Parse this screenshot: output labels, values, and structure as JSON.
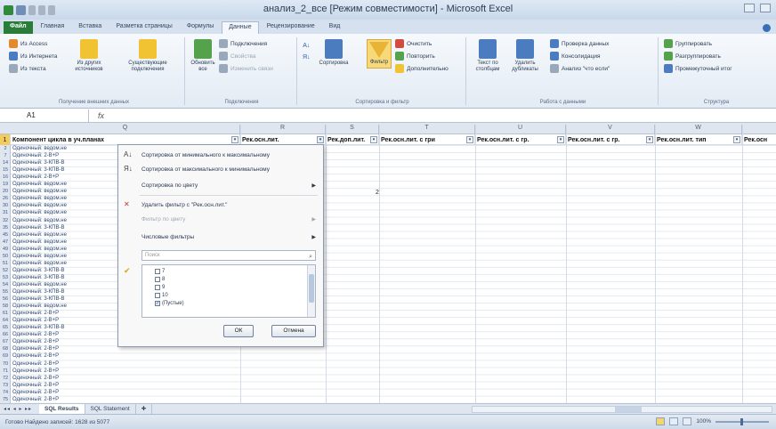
{
  "window": {
    "title": "анализ_2_все  [Режим совместимости]  -  Microsoft Excel"
  },
  "tabs": [
    {
      "label": "Файл"
    },
    {
      "label": "Главная"
    },
    {
      "label": "Вставка"
    },
    {
      "label": "Разметка страницы"
    },
    {
      "label": "Формулы"
    },
    {
      "label": "Данные"
    },
    {
      "label": "Рецензирование"
    },
    {
      "label": "Вид"
    }
  ],
  "ribbon": {
    "ext_data": {
      "from_access": "Из Access",
      "from_web": "Из Интернета",
      "from_text": "Из текста",
      "from_other": "Из других источников",
      "existing": "Существующие подключения",
      "label": "Получение внешних данных"
    },
    "connections": {
      "refresh_all": "Обновить все",
      "connections": "Подключения",
      "properties": "Свойства",
      "edit_links": "Изменить связи",
      "label": "Подключения"
    },
    "sort_filter": {
      "sort": "Сортировка",
      "filter": "Фильтр",
      "clear": "Очистить",
      "reapply": "Повторить",
      "advanced": "Дополнительно",
      "label": "Сортировка и фильтр"
    },
    "data_tools": {
      "text_to_columns": "Текст по столбцам",
      "remove_duplicates": "Удалить дубликаты",
      "validation": "Проверка данных",
      "consolidate": "Консолидация",
      "what_if": "Анализ \"что если\"",
      "label": "Работа с данными"
    },
    "outline": {
      "group": "Группировать",
      "ungroup": "Разгруппировать",
      "subtotal": "Промежуточный итог",
      "label": "Структура"
    }
  },
  "formula_bar": {
    "name_box": "A1",
    "fx": "fx",
    "value": ""
  },
  "columns": {
    "q": "Q",
    "r": "R",
    "s": "S",
    "t": "T",
    "u": "U",
    "v": "V",
    "w": "W"
  },
  "header_row": {
    "row_num": "1",
    "q": "Компонент цикла в уч.планах",
    "r": "Рек.осн.лит.",
    "s": "Рек.доп.лит.",
    "t": "Рек.осн.лит. с гри",
    "u": "Рек.осн.лит. с гр.",
    "v": "Рек.осн.лит. с гр.",
    "w": "Рек.осн.лит. тип",
    "x": "Рек.осн"
  },
  "rows": [
    {
      "num": "2",
      "q": "Одиночный: ведом.не"
    },
    {
      "num": "7",
      "q": "Одиночный: 2-В+Р"
    },
    {
      "num": "14",
      "q": "Одиночный: 3-КПВ-В"
    },
    {
      "num": "15",
      "q": "Одиночный: 3-КПВ-В"
    },
    {
      "num": "16",
      "q": "Одиночный: 2-В+Р"
    },
    {
      "num": "19",
      "q": "Одиночный: ведом.не"
    },
    {
      "num": "20",
      "q": "Одиночный: ведом.не"
    },
    {
      "num": "26",
      "q": "Одиночный: ведом.не"
    },
    {
      "num": "30",
      "q": "Одиночный: ведом.не"
    },
    {
      "num": "31",
      "q": "Одиночный: ведом.не"
    },
    {
      "num": "32",
      "q": "Одиночный: ведом.не"
    },
    {
      "num": "35",
      "q": "Одиночный: 3-КПВ-В"
    },
    {
      "num": "45",
      "q": "Одиночный: ведом.не"
    },
    {
      "num": "47",
      "q": "Одиночный: ведом.не"
    },
    {
      "num": "49",
      "q": "Одиночный: ведом.не"
    },
    {
      "num": "50",
      "q": "Одиночный: ведом.не"
    },
    {
      "num": "51",
      "q": "Одиночный: ведом.не"
    },
    {
      "num": "52",
      "q": "Одиночный: 3-КПВ-В"
    },
    {
      "num": "53",
      "q": "Одиночный: 3-КПВ-В"
    },
    {
      "num": "54",
      "q": "Одиночный: ведом.не"
    },
    {
      "num": "55",
      "q": "Одиночный: 3-КПВ-В"
    },
    {
      "num": "56",
      "q": "Одиночный: 3-КПВ-В"
    },
    {
      "num": "58",
      "q": "Одиночный: ведом.не"
    },
    {
      "num": "61",
      "q": "Одиночный: 2-В+Р"
    },
    {
      "num": "64",
      "q": "Одиночный: 2-В+Р"
    },
    {
      "num": "65",
      "q": "Одиночный: 3-КПВ-В"
    },
    {
      "num": "66",
      "q": "Одиночный: 2-В+Р"
    },
    {
      "num": "67",
      "q": "Одиночный: 2-В+Р"
    },
    {
      "num": "68",
      "q": "Одиночный: 2-В+Р"
    },
    {
      "num": "69",
      "q": "Одиночный: 2-В+Р"
    },
    {
      "num": "70",
      "q": "Одиночный: 2-В+Р"
    },
    {
      "num": "71",
      "q": "Одиночный: 2-В+Р"
    },
    {
      "num": "72",
      "q": "Одиночный: 2-В+Р"
    },
    {
      "num": "73",
      "q": "Одиночный: 2-В+Р"
    },
    {
      "num": "74",
      "q": "Одиночный: 2-В+Р"
    },
    {
      "num": "75",
      "q": "Одиночный: 2-В+Р"
    }
  ],
  "cell_value_s": "2",
  "filter_menu": {
    "sort_asc": "Сортировка от минимального к максимальному",
    "sort_desc": "Сортировка от максимального к минимальному",
    "sort_color": "Сортировка по цвету",
    "clear_filter": "Удалить фильтр с \"Рек.осн.лит.\"",
    "filter_color": "Фильтр по цвету",
    "number_filters": "Числовые фильтры",
    "search_placeholder": "Поиск",
    "items": [
      {
        "label": "7",
        "checked": false
      },
      {
        "label": "8",
        "checked": false
      },
      {
        "label": "9",
        "checked": false
      },
      {
        "label": "10",
        "checked": false
      },
      {
        "label": "(Пустые)",
        "checked": true
      }
    ],
    "ok": "ОК",
    "cancel": "Отмена"
  },
  "sheets": [
    {
      "label": "SQL Results",
      "active": true
    },
    {
      "label": "SQL Statement",
      "active": false
    }
  ],
  "status": {
    "text": "Готово   Найдено записей: 1628 из 5077",
    "zoom": "100%"
  },
  "colors": {
    "accent": "#2a7d38",
    "ribbon_bg": "#e3ebf4",
    "filter_active": "#f7d97a"
  }
}
